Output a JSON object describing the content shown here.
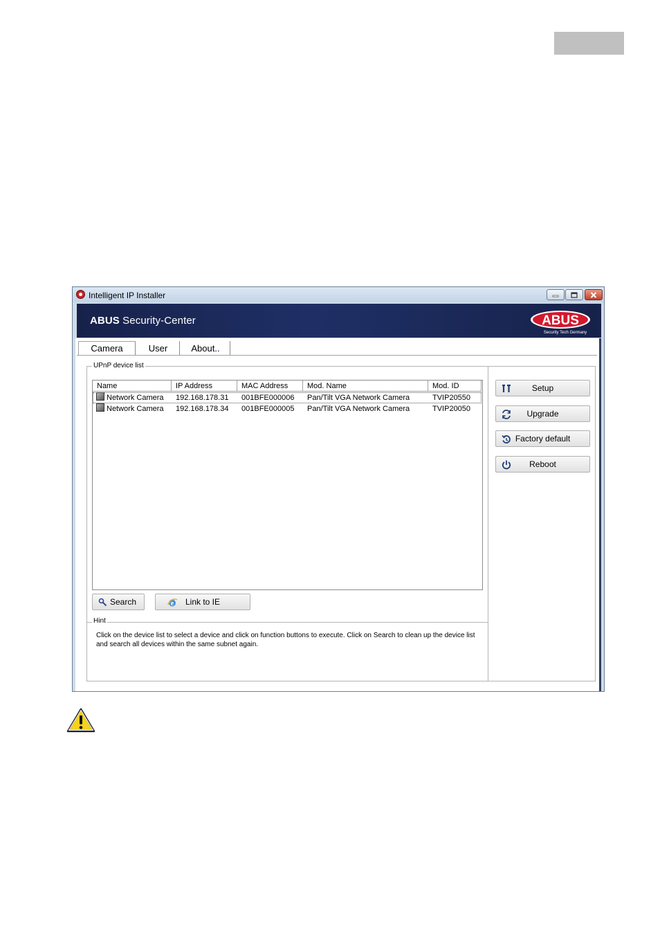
{
  "window": {
    "title": "Intelligent IP Installer",
    "banner_brand": "ABUS",
    "banner_title": " Security-Center",
    "logo_text": "ABUS",
    "logo_subtext": "Security Tech Germany"
  },
  "tabs": [
    {
      "label": "Camera",
      "active": true
    },
    {
      "label": "User",
      "active": false
    },
    {
      "label": "About..",
      "active": false
    }
  ],
  "device_list": {
    "legend": "UPnP device list",
    "columns": [
      "Name",
      "IP Address",
      "MAC Address",
      "Mod. Name",
      "Mod. ID"
    ],
    "rows": [
      {
        "name": "Network Camera",
        "ip": "192.168.178.31",
        "mac": "001BFE000006",
        "model_name": "Pan/Tilt VGA Network Camera",
        "model_id": "TVIP20550",
        "selected": true
      },
      {
        "name": "Network Camera",
        "ip": "192.168.178.34",
        "mac": "001BFE000005",
        "model_name": "Pan/Tilt VGA Network Camera",
        "model_id": "TVIP20050",
        "selected": false
      }
    ]
  },
  "buttons": {
    "search": "Search",
    "link_ie": "Link to IE",
    "setup": "Setup",
    "upgrade": "Upgrade",
    "factory_default": "Factory default",
    "reboot": "Reboot"
  },
  "hint": {
    "legend": "Hint",
    "text": "Click on the device list to select a device and click on function buttons to execute. Click on Search to clean up the device list and search all devices  within the same subnet again."
  },
  "colors": {
    "banner": "#1f2f66",
    "logo_red": "#d3192e",
    "warning_yellow": "#f5d21b"
  }
}
